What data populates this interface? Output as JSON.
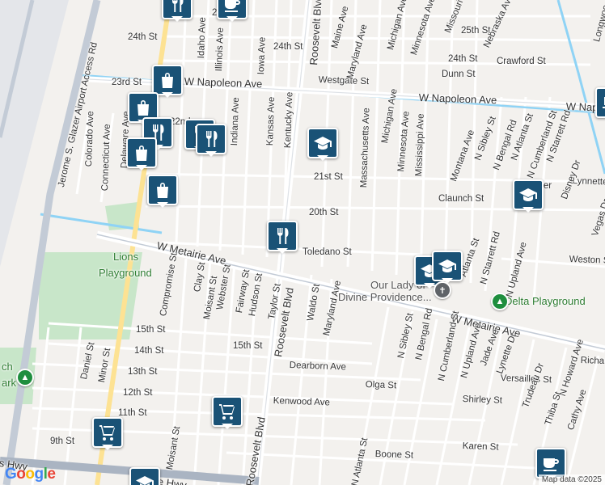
{
  "map": {
    "attribution": "Map data ©2025",
    "logo": "Google",
    "colors": {
      "land": "#f3f1ee",
      "road": "#ffffff",
      "arterial": "#fde293",
      "highway": "#c3cbd6",
      "water": "#8fd3f5",
      "park": "#c8e6c9",
      "pin": "#1a5276"
    }
  },
  "labels": [
    {
      "id": "25th-st-top",
      "text": "25th St",
      "kind": "road"
    },
    {
      "id": "25th-st-right",
      "text": "25th St",
      "kind": "road"
    },
    {
      "id": "24th-st-left",
      "text": "24th St",
      "kind": "road"
    },
    {
      "id": "24th-st-mid",
      "text": "24th St",
      "kind": "road"
    },
    {
      "id": "24th-st-right",
      "text": "24th St",
      "kind": "road"
    },
    {
      "id": "23rd-st",
      "text": "23rd St",
      "kind": "road"
    },
    {
      "id": "napoleon-left",
      "text": "W Napoleon Ave",
      "kind": "big"
    },
    {
      "id": "napoleon-mid",
      "text": "W Napoleon Ave",
      "kind": "big"
    },
    {
      "id": "napoleon-right",
      "text": "W Napoleon Ave",
      "kind": "big"
    },
    {
      "id": "westgate",
      "text": "Westgate St",
      "kind": "road"
    },
    {
      "id": "crawford",
      "text": "Crawford St",
      "kind": "road"
    },
    {
      "id": "dunn",
      "text": "Dunn St",
      "kind": "road"
    },
    {
      "id": "22nd",
      "text": "22nd",
      "kind": "road"
    },
    {
      "id": "21st-st",
      "text": "21st St",
      "kind": "road"
    },
    {
      "id": "20th-st",
      "text": "20th St",
      "kind": "road"
    },
    {
      "id": "claunch",
      "text": "Claunch St",
      "kind": "road"
    },
    {
      "id": "toledano",
      "text": "Toledano St",
      "kind": "road"
    },
    {
      "id": "metairie-left",
      "text": "W Metairie Ave",
      "kind": "big"
    },
    {
      "id": "metairie-right",
      "text": "W Metairie Ave",
      "kind": "big"
    },
    {
      "id": "15th-left",
      "text": "15th St",
      "kind": "road"
    },
    {
      "id": "15th-mid",
      "text": "15th St",
      "kind": "road"
    },
    {
      "id": "14th",
      "text": "14th St",
      "kind": "road"
    },
    {
      "id": "13th",
      "text": "13th St",
      "kind": "road"
    },
    {
      "id": "12th",
      "text": "12th St",
      "kind": "road"
    },
    {
      "id": "11th",
      "text": "11th St",
      "kind": "road"
    },
    {
      "id": "9th",
      "text": "9th St",
      "kind": "road"
    },
    {
      "id": "dearborn",
      "text": "Dearborn Ave",
      "kind": "road"
    },
    {
      "id": "kenwood",
      "text": "Kenwood Ave",
      "kind": "road"
    },
    {
      "id": "olga",
      "text": "Olga St",
      "kind": "road"
    },
    {
      "id": "shirley",
      "text": "Shirley St",
      "kind": "road"
    },
    {
      "id": "versailles",
      "text": "Versailles St",
      "kind": "road"
    },
    {
      "id": "karen",
      "text": "Karen St",
      "kind": "road"
    },
    {
      "id": "boone",
      "text": "Boone St",
      "kind": "road"
    },
    {
      "id": "jay",
      "text": "Jay S",
      "kind": "road"
    },
    {
      "id": "weston",
      "text": "Weston St",
      "kind": "road"
    },
    {
      "id": "lynnette",
      "text": "Lynnette",
      "kind": "road"
    },
    {
      "id": "balter",
      "text": "Balter",
      "kind": "road"
    },
    {
      "id": "richard",
      "text": "Richar",
      "kind": "road"
    },
    {
      "id": "airport-rd",
      "text": "Jerome S. Glazer Airport Access Rd",
      "kind": "road"
    },
    {
      "id": "roosevelt-top",
      "text": "Roosevelt Blvd",
      "kind": "big"
    },
    {
      "id": "roosevelt-mid",
      "text": "Roosevelt Blvd",
      "kind": "big"
    },
    {
      "id": "roosevelt-bot",
      "text": "Roosevelt Blvd",
      "kind": "big"
    },
    {
      "id": "idaho",
      "text": "Idaho Ave",
      "kind": "road"
    },
    {
      "id": "illinois",
      "text": "Illinois Ave",
      "kind": "road"
    },
    {
      "id": "iowa",
      "text": "Iowa Ave",
      "kind": "road"
    },
    {
      "id": "indiana",
      "text": "Indiana Ave",
      "kind": "road"
    },
    {
      "id": "kansas",
      "text": "Kansas Ave",
      "kind": "road"
    },
    {
      "id": "kentucky",
      "text": "Kentucky Ave",
      "kind": "road"
    },
    {
      "id": "maine",
      "text": "Maine Ave",
      "kind": "road"
    },
    {
      "id": "maryland-top",
      "text": "Maryland Ave",
      "kind": "road"
    },
    {
      "id": "maryland-bot",
      "text": "Maryland Ave",
      "kind": "road"
    },
    {
      "id": "michigan-top",
      "text": "Michigan Ave",
      "kind": "road"
    },
    {
      "id": "michigan-mid",
      "text": "Michigan Ave",
      "kind": "road"
    },
    {
      "id": "minnesota-top",
      "text": "Minnesota Ave",
      "kind": "road"
    },
    {
      "id": "minnesota-mid",
      "text": "Minnesota Ave",
      "kind": "road"
    },
    {
      "id": "missouri",
      "text": "Missouri A",
      "kind": "road"
    },
    {
      "id": "nebraska",
      "text": "Nebraska Ave",
      "kind": "road"
    },
    {
      "id": "longwood",
      "text": "Longwoo",
      "kind": "road"
    },
    {
      "id": "massachusetts",
      "text": "Massachusetts Ave",
      "kind": "road"
    },
    {
      "id": "mississippi",
      "text": "Mississippi Ave",
      "kind": "road"
    },
    {
      "id": "montana",
      "text": "Montana Ave",
      "kind": "road"
    },
    {
      "id": "sibley-top",
      "text": "N Sibley St",
      "kind": "road"
    },
    {
      "id": "sibley-bot",
      "text": "N Sibley St",
      "kind": "road"
    },
    {
      "id": "bengal-top",
      "text": "N Bengal Rd",
      "kind": "road"
    },
    {
      "id": "bengal-bot",
      "text": "N Bengal Rd",
      "kind": "road"
    },
    {
      "id": "atlanta-top",
      "text": "N Atlanta St",
      "kind": "road"
    },
    {
      "id": "atlanta-mid",
      "text": "Atlanta St",
      "kind": "road"
    },
    {
      "id": "atlanta-bot",
      "text": "N Atlanta St",
      "kind": "road"
    },
    {
      "id": "cumberland-top",
      "text": "N Cumberland St",
      "kind": "road"
    },
    {
      "id": "cumberland-bot",
      "text": "N Cumberland St",
      "kind": "road"
    },
    {
      "id": "starrett-top",
      "text": "N Starrett Rd",
      "kind": "road"
    },
    {
      "id": "starrett-mid",
      "text": "N Starrett Rd",
      "kind": "road"
    },
    {
      "id": "upland-mid",
      "text": "N Upland Ave",
      "kind": "road"
    },
    {
      "id": "upland-bot",
      "text": "N Upland Ave",
      "kind": "road"
    },
    {
      "id": "jade",
      "text": "Jade Ave",
      "kind": "road"
    },
    {
      "id": "lynette-dr",
      "text": "Lynette Dr",
      "kind": "road"
    },
    {
      "id": "trudeau",
      "text": "Trudeau Dr",
      "kind": "road"
    },
    {
      "id": "howard",
      "text": "N Howard Ave",
      "kind": "road"
    },
    {
      "id": "thiba",
      "text": "Thiba St",
      "kind": "road"
    },
    {
      "id": "cathy",
      "text": "Cathy Ave",
      "kind": "road"
    },
    {
      "id": "disney",
      "text": "Disney Dr",
      "kind": "road"
    },
    {
      "id": "vegas",
      "text": "Vegas Dr",
      "kind": "road"
    },
    {
      "id": "colorado",
      "text": "Colorado Ave",
      "kind": "road"
    },
    {
      "id": "connecticut",
      "text": "Connecticut Ave",
      "kind": "road"
    },
    {
      "id": "delaware",
      "text": "Delaware Ave",
      "kind": "road"
    },
    {
      "id": "compromise",
      "text": "Compromise St",
      "kind": "road"
    },
    {
      "id": "clay",
      "text": "Clay St",
      "kind": "road"
    },
    {
      "id": "moisant-top",
      "text": "Moisant St",
      "kind": "road"
    },
    {
      "id": "moisant-bot",
      "text": "Moisant St",
      "kind": "road"
    },
    {
      "id": "webster",
      "text": "Webster St",
      "kind": "road"
    },
    {
      "id": "fairway",
      "text": "Fairway St",
      "kind": "road"
    },
    {
      "id": "hudson",
      "text": "Hudson St",
      "kind": "road"
    },
    {
      "id": "taylor",
      "text": "Taylor St",
      "kind": "road"
    },
    {
      "id": "waldo",
      "text": "Waldo St",
      "kind": "road"
    },
    {
      "id": "daniel",
      "text": "Daniel St",
      "kind": "road"
    },
    {
      "id": "minor",
      "text": "Minor St",
      "kind": "road"
    },
    {
      "id": "hwy-left",
      "text": "s Hwy",
      "kind": "big"
    },
    {
      "id": "hwy-mid",
      "text": "e Hwy",
      "kind": "big"
    },
    {
      "id": "lions-1",
      "text": "Lions",
      "kind": "park"
    },
    {
      "id": "lions-2",
      "text": "Playground",
      "kind": "park"
    },
    {
      "id": "delta",
      "text": "Delta Playground",
      "kind": "park"
    },
    {
      "id": "park-ch",
      "text": "ch",
      "kind": "park"
    },
    {
      "id": "park-ark",
      "text": "ark",
      "kind": "park"
    },
    {
      "id": "ourlady-1",
      "text": "Our Lady of",
      "kind": "poi"
    },
    {
      "id": "ourlady-2",
      "text": "Divine Providence...",
      "kind": "poi"
    }
  ],
  "pins": [
    {
      "id": "pin-restaurant-top",
      "icon": "fork-knife-icon"
    },
    {
      "id": "pin-coffee-top",
      "icon": "coffee-icon"
    },
    {
      "id": "pin-shopping-napoleon",
      "icon": "shopping-bag-icon"
    },
    {
      "id": "pin-shopping-1",
      "icon": "shopping-bag-icon"
    },
    {
      "id": "pin-restaurant-2",
      "icon": "fork-knife-icon"
    },
    {
      "id": "pin-restaurant-3",
      "icon": "fork-knife-icon"
    },
    {
      "id": "pin-restaurant-4",
      "icon": "fork-knife-icon"
    },
    {
      "id": "pin-school-21st",
      "icon": "school-icon"
    },
    {
      "id": "pin-shopping-2",
      "icon": "shopping-bag-icon"
    },
    {
      "id": "pin-shopping-3",
      "icon": "shopping-bag-icon"
    },
    {
      "id": "pin-restaurant-toledano",
      "icon": "fork-knife-icon"
    },
    {
      "id": "pin-school-right",
      "icon": "school-icon"
    },
    {
      "id": "pin-school-ourlady",
      "icon": "school-icon"
    },
    {
      "id": "pin-school-ourlady-2",
      "icon": "school-icon"
    },
    {
      "id": "pin-cart-mid",
      "icon": "shopping-cart-icon"
    },
    {
      "id": "pin-cart-left",
      "icon": "shopping-cart-icon"
    },
    {
      "id": "pin-school-bottom",
      "icon": "school-icon"
    },
    {
      "id": "pin-coffee-bottom",
      "icon": "coffee-icon"
    },
    {
      "id": "pin-laptop-right",
      "icon": "laptop-icon"
    }
  ]
}
